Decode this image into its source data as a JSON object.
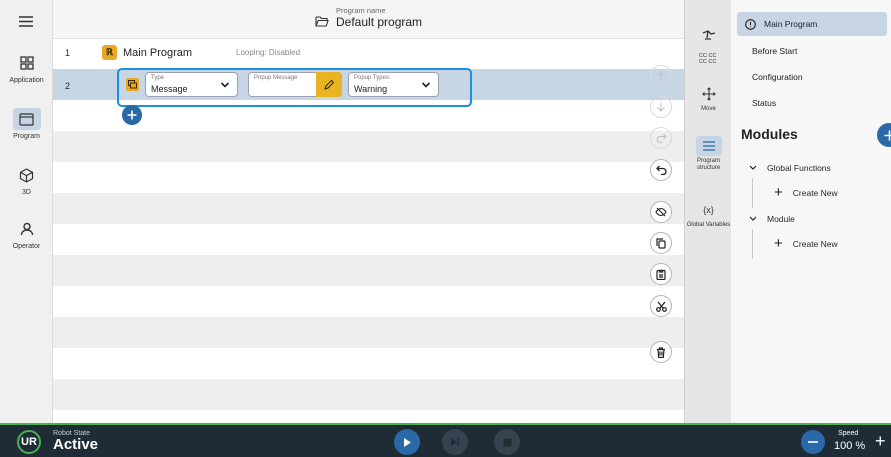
{
  "nav": {
    "items": [
      {
        "label": "Application",
        "icon": "application-grid-icon"
      },
      {
        "label": "Program",
        "icon": "program-icon"
      },
      {
        "label": "3D",
        "icon": "cube-3d-icon"
      },
      {
        "label": "Operator",
        "icon": "operator-person-icon"
      }
    ],
    "active": "Program"
  },
  "header": {
    "program_name_label": "Program name",
    "program_name": "Default program"
  },
  "program": {
    "rows": [
      {
        "number": "1",
        "title": "Main Program",
        "looping": "Looping: Disabled"
      },
      {
        "number": "2"
      }
    ],
    "node": {
      "type_label": "Type",
      "type_value": "Message",
      "popup_message_label": "Popup Message",
      "popup_message_value": "",
      "popup_types_label": "Popup Types:",
      "popup_types_value": "Warning"
    }
  },
  "tools": [
    {
      "label": "",
      "icon": "robot-arm-icon"
    },
    {
      "label": "",
      "icon": "cc-cc-icon",
      "text": "CC CC\nCC CC"
    },
    {
      "label": "Move",
      "icon": "move-arrows-icon"
    },
    {
      "label": "Program structure",
      "icon": "program-structure-icon"
    },
    {
      "label": "Global Variables",
      "icon": "global-variables-icon",
      "text": "{x}"
    }
  ],
  "right_panel": {
    "main_program": "Main Program",
    "links": [
      "Before Start",
      "Configuration",
      "Status"
    ],
    "modules_title": "Modules",
    "global_functions": "Global Functions",
    "module": "Module",
    "create_new": "Create New"
  },
  "bottom_bar": {
    "ur_logo_text": "UR",
    "robot_state_label": "Robot State",
    "robot_state": "Active",
    "speed_label": "Speed",
    "speed_value": "100 %"
  },
  "colors": {
    "accent_blue": "#2a68a8",
    "selection_frame": "#1d8fe0",
    "ur_yellow": "#e9a825",
    "bottom_bar": "#1f2c36",
    "status_green": "#4caf50"
  }
}
